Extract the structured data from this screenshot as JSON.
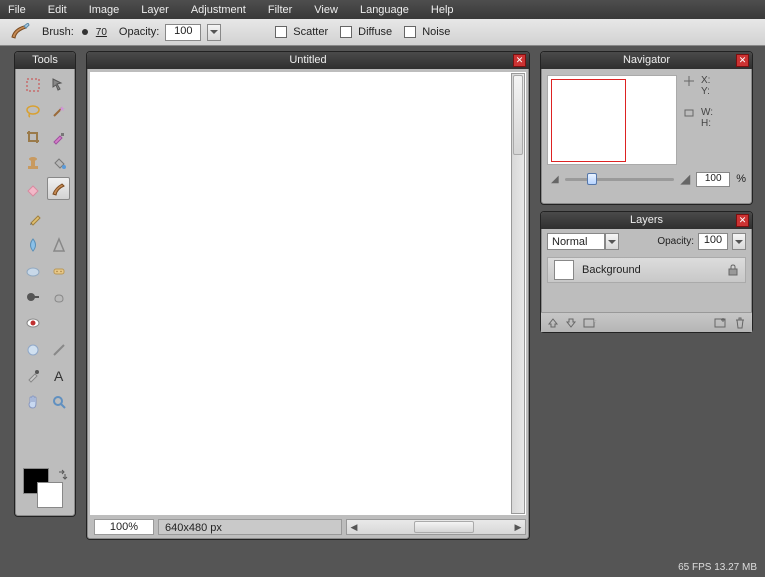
{
  "menu": [
    "File",
    "Edit",
    "Image",
    "Layer",
    "Adjustment",
    "Filter",
    "View",
    "Language",
    "Help"
  ],
  "options": {
    "brush_label": "Brush:",
    "brush_size": "70",
    "opacity_label": "Opacity:",
    "opacity_value": "100",
    "scatter_label": "Scatter",
    "diffuse_label": "Diffuse",
    "noise_label": "Noise"
  },
  "tools_title": "Tools",
  "document": {
    "title": "Untitled",
    "zoom": "100%",
    "dimensions": "640x480 px"
  },
  "navigator": {
    "title": "Navigator",
    "x_label": "X:",
    "y_label": "Y:",
    "w_label": "W:",
    "h_label": "H:",
    "zoom_value": "100",
    "zoom_percent": "%"
  },
  "layers": {
    "title": "Layers",
    "blend_mode": "Normal",
    "opacity_label": "Opacity:",
    "opacity_value": "100",
    "layer_name": "Background"
  },
  "status": "65 FPS 13.27 MB",
  "swatches": {
    "fg": "#000000",
    "bg": "#ffffff"
  }
}
